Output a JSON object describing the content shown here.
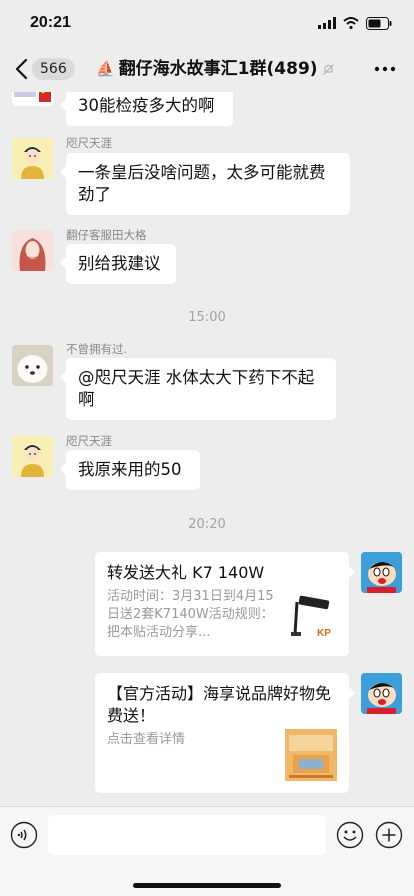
{
  "status_bar": {
    "time": "20:21"
  },
  "nav": {
    "back_count": "566",
    "title_emoji": "⛵",
    "title": "翻仔海水故事汇1群(489)",
    "icons": {
      "back": "chevron-left-icon",
      "mute": "bell-off-icon",
      "more": "more-dots-icon"
    }
  },
  "messages": [
    {
      "sender": "",
      "text": "30能检疫多大的啊",
      "avatar": "flag-avatar"
    },
    {
      "sender": "咫尺天涯",
      "text": "一条皇后没啥问题，太多可能就费劲了",
      "avatar": "cartoon-figure-avatar"
    },
    {
      "sender": "翻仔客服田大格",
      "text": "别给我建议",
      "avatar": "girl-portrait-avatar"
    },
    {
      "sender": "不曾拥有过.",
      "text": "@咫尺天涯 水体太大下药下不起啊",
      "avatar": "white-dog-avatar"
    },
    {
      "sender": "咫尺天涯",
      "text": "我原来用的50",
      "avatar": "cartoon-figure-avatar"
    }
  ],
  "time_dividers": [
    "15:00",
    "20:20"
  ],
  "cards": [
    {
      "title": "转发送大礼 K7 140W",
      "desc": "活动时间：3月31日到4月15日送2套K7140W活动规则：把本贴活动分享...",
      "thumb": "lamp-product-thumb"
    },
    {
      "title": "【官方活动】海享说品牌好物免费送！",
      "desc": "点击查看详情",
      "thumb": "poster-thumb"
    }
  ],
  "input_bar": {
    "placeholder": "",
    "icons": {
      "voice": "voice-icon",
      "emoji": "emoji-icon",
      "plus": "plus-icon"
    }
  }
}
